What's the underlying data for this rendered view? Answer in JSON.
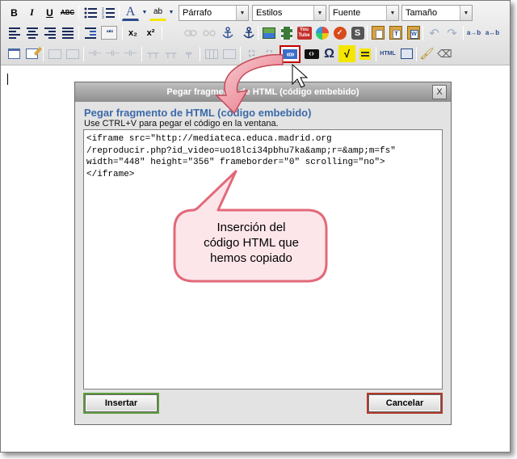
{
  "toolbar": {
    "format_select": "Párrafo",
    "styles_select": "Estilos",
    "font_select": "Fuente",
    "size_select": "Tamaño",
    "bold": "B",
    "italic": "I",
    "underline": "U",
    "strike": "ABC",
    "font_color": "A",
    "highlight": "ab",
    "quote": "““",
    "subscript": "x₂",
    "superscript": "x²",
    "omega": "Ω",
    "html_label": "HTML",
    "youtube_label": "You Tube"
  },
  "dialog": {
    "title": "Pegar fragmento de HTML (código embebido)",
    "heading": "Pegar fragmento de HTML (código embebido)",
    "instructions": "Use CTRL+V para pegar el código en la ventana.",
    "code": "<iframe src=\"http://mediateca.educa.madrid.org\n/reproducir.php?id_video=uo18lci34pbhu7ka&amp;r=&amp;m=fs\"\nwidth=\"448\" height=\"356\" frameborder=\"0\" scrolling=\"no\">\n</iframe>",
    "insert_label": "Insertar",
    "cancel_label": "Cancelar",
    "close_glyph": "X"
  },
  "callout": {
    "text": "Inserción del\ncódigo HTML que\nhemos copiado",
    "fill_color": "#fde6ea",
    "stroke_color": "#e26a7a"
  },
  "icons": [
    "bold-icon",
    "italic-icon",
    "underline-icon",
    "strikethrough-icon",
    "bullet-list-icon",
    "numbered-list-icon",
    "font-color-icon",
    "highlight-icon",
    "align-left-icon",
    "align-center-icon",
    "align-right-icon",
    "justify-icon",
    "outdent-icon",
    "blockquote-icon",
    "subscript-icon",
    "superscript-icon",
    "link-icon",
    "unlink-icon",
    "anchor-icon",
    "image-icon",
    "video-icon",
    "youtube-icon",
    "media-icon",
    "spellcheck-icon",
    "skype-icon",
    "paste-icon",
    "paste-text-icon",
    "paste-word-icon",
    "undo-icon",
    "redo-icon",
    "find-replace-icon",
    "embed-html-icon",
    "omega-icon",
    "sqrt-icon",
    "source-html-icon",
    "cleanup-icon",
    "eraser-icon",
    "cursor-icon"
  ]
}
